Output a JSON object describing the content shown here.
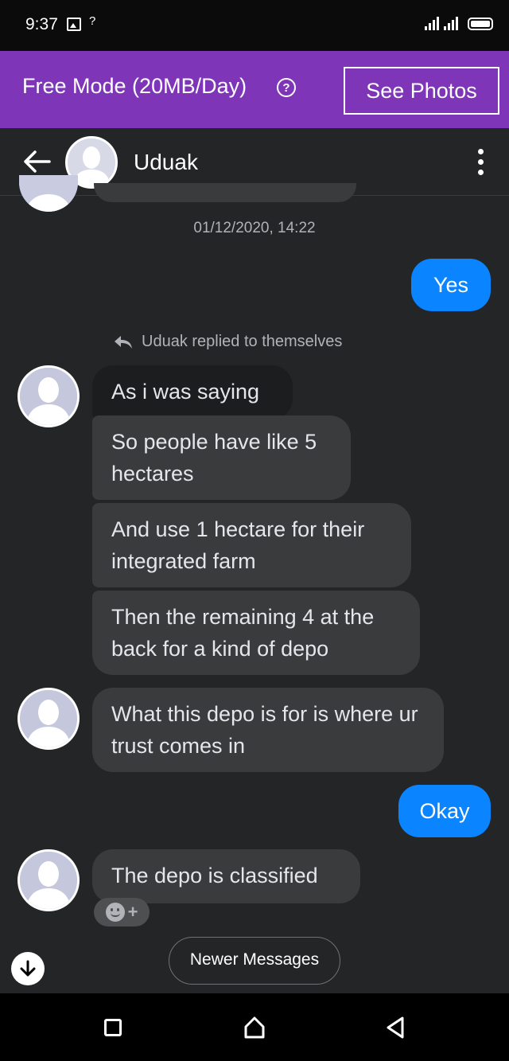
{
  "status_bar": {
    "time": "9:37",
    "signal_note": "?"
  },
  "banner": {
    "text": "Free Mode (20MB/Day)",
    "help_glyph": "?",
    "see_photos_label": "See Photos",
    "color": "#7e35b8"
  },
  "header": {
    "contact_name": "Uduak"
  },
  "timestamp": "01/12/2020, 14:22",
  "reply_note": "Uduak replied to themselves",
  "messages": {
    "m1": "Yes",
    "m2": "As i was saying",
    "m3": "So people have like 5 hectares",
    "m4": "And use 1 hectare for their integrated farm",
    "m5": "Then the remaining 4 at the back for a kind of depo",
    "m6": "What this depo is for is where ur trust comes in",
    "m7": "Okay",
    "m8": "The depo is classified"
  },
  "react_plus": "+",
  "newer_messages_label": "Newer Messages",
  "colors": {
    "outgoing": "#0a84ff",
    "incoming": "#3a3b3c",
    "background": "#242526"
  }
}
